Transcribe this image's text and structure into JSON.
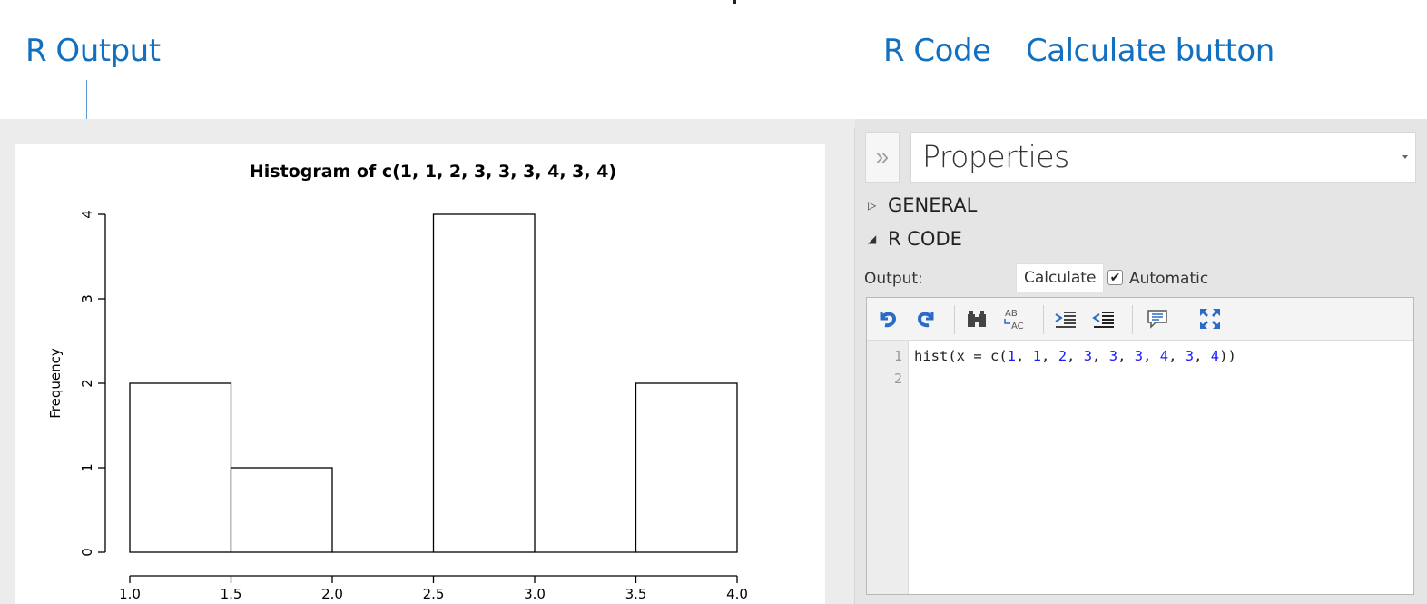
{
  "annotations": {
    "r_output": "R Output",
    "r_code": "R Code",
    "calculate_button": "Calculate button"
  },
  "properties": {
    "collapse_glyph": "»",
    "title": "Properties",
    "sections": [
      {
        "label": "GENERAL",
        "expanded": false,
        "glyph": "▷"
      },
      {
        "label": "R CODE",
        "expanded": true,
        "glyph": "◢"
      }
    ],
    "output_label": "Output:",
    "calculate_label": "Calculate",
    "automatic_label": "Automatic",
    "automatic_checked": true,
    "automatic_check_glyph": "✔"
  },
  "editor": {
    "toolbar": [
      "undo-icon",
      "redo-icon",
      "find-icon",
      "replace-icon",
      "indent-icon",
      "outdent-icon",
      "comment-icon",
      "fullscreen-icon"
    ],
    "lines": [
      {
        "number": "1",
        "tokens": [
          {
            "t": "hist(x = c(",
            "c": "txt"
          },
          {
            "t": "1",
            "c": "num"
          },
          {
            "t": ", ",
            "c": "txt"
          },
          {
            "t": "1",
            "c": "num"
          },
          {
            "t": ", ",
            "c": "txt"
          },
          {
            "t": "2",
            "c": "num"
          },
          {
            "t": ", ",
            "c": "txt"
          },
          {
            "t": "3",
            "c": "num"
          },
          {
            "t": ", ",
            "c": "txt"
          },
          {
            "t": "3",
            "c": "num"
          },
          {
            "t": ", ",
            "c": "txt"
          },
          {
            "t": "3",
            "c": "num"
          },
          {
            "t": ", ",
            "c": "txt"
          },
          {
            "t": "4",
            "c": "num"
          },
          {
            "t": ", ",
            "c": "txt"
          },
          {
            "t": "3",
            "c": "num"
          },
          {
            "t": ", ",
            "c": "txt"
          },
          {
            "t": "4",
            "c": "num"
          },
          {
            "t": "))",
            "c": "txt"
          }
        ]
      },
      {
        "number": "2",
        "tokens": []
      }
    ]
  },
  "chart_data": {
    "type": "bar",
    "title": "Histogram of c(1, 1, 2, 3, 3, 3, 4, 3, 4)",
    "xlabel": "",
    "ylabel": "Frequency",
    "bins": [
      [
        1.0,
        1.5
      ],
      [
        1.5,
        2.0
      ],
      [
        2.0,
        2.5
      ],
      [
        2.5,
        3.0
      ],
      [
        3.0,
        3.5
      ],
      [
        3.5,
        4.0
      ]
    ],
    "values": [
      2,
      1,
      0,
      4,
      0,
      2
    ],
    "xlim": [
      1.0,
      4.0
    ],
    "ylim": [
      0,
      4
    ],
    "xticks": [
      "1.0",
      "1.5",
      "2.0",
      "2.5",
      "3.0",
      "3.5",
      "4.0"
    ],
    "yticks": [
      "0",
      "1",
      "2",
      "3",
      "4"
    ],
    "grid": false,
    "colors": {
      "fill": "#ffffff",
      "stroke": "#000000"
    }
  }
}
